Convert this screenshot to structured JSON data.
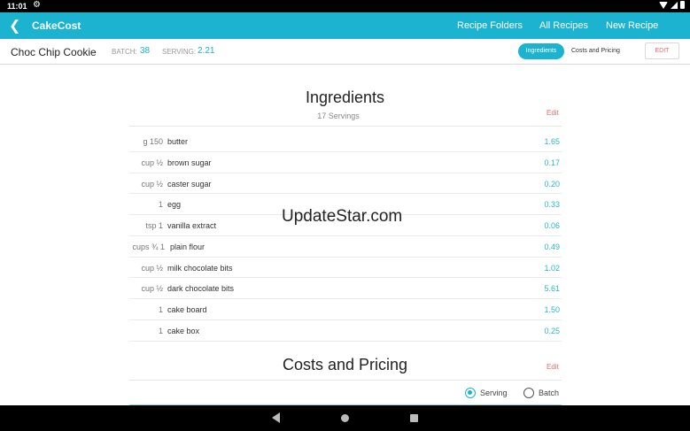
{
  "status": {
    "time": "11:01"
  },
  "appbar": {
    "title": "CakeCost",
    "nav": [
      "Recipe Folders",
      "All Recipes",
      "New Recipe"
    ]
  },
  "recipe": {
    "name": "Choc Chip Cookie",
    "batch_label": "BATCH:",
    "batch_value": "38",
    "serving_label": "SERVING:",
    "serving_value": "2.21",
    "tab_active": "Ingredients",
    "tab_other": "Costs and Pricing",
    "edit_label": "EDIT"
  },
  "ingredients": {
    "title": "Ingredients",
    "servings": "17 Servings",
    "edit": "Edit",
    "items": [
      {
        "qty": "150 g",
        "name": "butter",
        "cost": "1.65"
      },
      {
        "qty": "½ cup",
        "name": "brown sugar",
        "cost": "0.17"
      },
      {
        "qty": "½ cup",
        "name": "caster sugar",
        "cost": "0.20"
      },
      {
        "qty": "1",
        "name": "egg",
        "cost": "0.33"
      },
      {
        "qty": "1 tsp",
        "name": "vanilla extract",
        "cost": "0.06"
      },
      {
        "qty": "1 ¾ cups",
        "name": "plain flour",
        "cost": "0.49"
      },
      {
        "qty": "½ cup",
        "name": "milk chocolate bits",
        "cost": "1.02"
      },
      {
        "qty": "½ cup",
        "name": "dark chocolate bits",
        "cost": "5.61"
      },
      {
        "qty": "1",
        "name": "cake board",
        "cost": "1.50"
      },
      {
        "qty": "1",
        "name": "cake box",
        "cost": "0.25"
      }
    ]
  },
  "costs": {
    "title": "Costs and Pricing",
    "edit": "Edit",
    "options": [
      "Serving",
      "Batch"
    ],
    "selected": "Serving"
  },
  "watermark": "UpdateStar.com",
  "colors": {
    "accent": "#1bb3cf",
    "edit": "#e96c6c",
    "cost": "#2bb4d3"
  },
  "icons": [
    "gear-icon",
    "wifi-icon",
    "signal-icon",
    "battery-icon",
    "back-arrow-icon",
    "nav-back-icon",
    "nav-home-icon",
    "nav-recents-icon"
  ]
}
